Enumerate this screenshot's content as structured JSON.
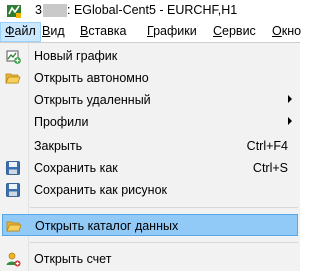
{
  "window": {
    "title_prefix": "3",
    "title": ": EGlobal-Cent5 - EURCHF,H1"
  },
  "menubar": {
    "items": [
      {
        "label": "Файл",
        "mnemonic": "Ф",
        "rest": "айл"
      },
      {
        "label": "Вид",
        "mnemonic": "В",
        "rest": "ид"
      },
      {
        "label": "Вставка",
        "mnemonic": "В",
        "rest": "ставка"
      },
      {
        "label": "Графики",
        "mnemonic": "Г",
        "rest": "рафики"
      },
      {
        "label": "Сервис",
        "mnemonic": "С",
        "rest": "ервис"
      },
      {
        "label": "Окно",
        "mnemonic": "О",
        "rest": "кно"
      }
    ]
  },
  "file_menu": {
    "items": [
      {
        "label": "Новый график",
        "shortcut": "",
        "icon": "new-chart-icon",
        "submenu": false
      },
      {
        "label": "Открыть автономно",
        "shortcut": "",
        "icon": "folder-open-icon",
        "submenu": false
      },
      {
        "label": "Открыть удаленный",
        "shortcut": "",
        "icon": "",
        "submenu": true
      },
      {
        "label": "Профили",
        "shortcut": "",
        "icon": "",
        "submenu": true
      },
      {
        "label": "Закрыть",
        "shortcut": "Ctrl+F4",
        "icon": "",
        "submenu": false
      },
      {
        "label": "Сохранить как",
        "shortcut": "Ctrl+S",
        "icon": "save-icon",
        "submenu": false
      },
      {
        "label": "Сохранить как рисунок",
        "shortcut": "",
        "icon": "save-picture-icon",
        "submenu": false
      },
      {
        "label": "Открыть каталог данных",
        "shortcut": "",
        "icon": "folder-open-icon",
        "submenu": false,
        "highlighted": true
      },
      {
        "label": "Открыть счет",
        "shortcut": "",
        "icon": "open-account-icon",
        "submenu": false
      }
    ]
  },
  "colors": {
    "highlight_bg": "#91c9f7",
    "highlight_border": "#5aa7e8",
    "menu_bg": "#f2f2f2"
  }
}
